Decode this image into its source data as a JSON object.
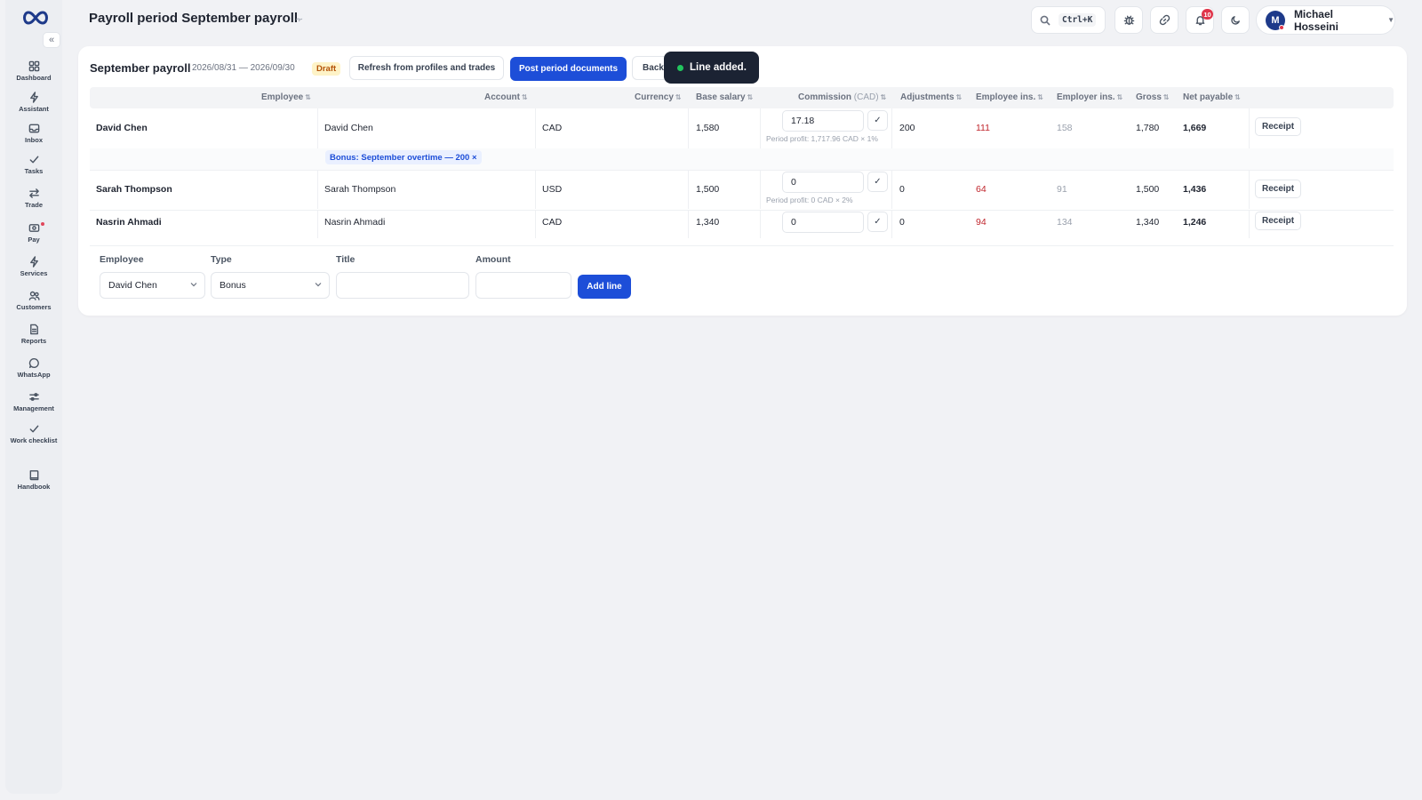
{
  "header": {
    "title": "Payroll period September payroll",
    "search_shortcut": "Ctrl+K",
    "notifications_count": "10",
    "user_initial": "M",
    "user_name": "Michael Hosseini"
  },
  "sidebar": {
    "collapse_glyph": "«",
    "items": [
      {
        "label": "Dashboard",
        "icon": "dashboard-icon"
      },
      {
        "label": "Assistant",
        "icon": "lightning-icon"
      },
      {
        "label": "Inbox",
        "icon": "inbox-icon"
      },
      {
        "label": "Tasks",
        "icon": "check-icon"
      },
      {
        "label": "Trade",
        "icon": "swap-icon"
      },
      {
        "label": "Pay",
        "icon": "wallet-icon"
      },
      {
        "label": "Services",
        "icon": "lightning-icon"
      },
      {
        "label": "Customers",
        "icon": "users-icon"
      },
      {
        "label": "Reports",
        "icon": "document-icon"
      },
      {
        "label": "WhatsApp",
        "icon": "chat-icon"
      },
      {
        "label": "Management",
        "icon": "sliders-icon"
      },
      {
        "label": "Work checklist",
        "icon": "check-icon"
      },
      {
        "label": "Handbook",
        "icon": "book-icon"
      }
    ]
  },
  "period": {
    "title": "September payroll",
    "date_range": "2026/08/31 — 2026/09/30",
    "status": "Draft",
    "refresh_label": "Refresh from profiles and trades",
    "post_label": "Post period documents",
    "back_label": "Back"
  },
  "toast": {
    "message": "Line added."
  },
  "table": {
    "columns": {
      "employee": "Employee",
      "account": "Account",
      "currency": "Currency",
      "base_salary": "Base salary",
      "commission": "Commission",
      "commission_unit": "(CAD)",
      "adjustments": "Adjustments",
      "employee_ins": "Employee ins.",
      "employer_ins": "Employer ins.",
      "gross": "Gross",
      "net_payable": "Net payable"
    },
    "sort_glyph": "⇅",
    "rows": [
      {
        "employee": "David Chen",
        "account": "David Chen",
        "currency": "CAD",
        "base_salary": "1,580",
        "commission": "17.18",
        "commission_hint": "Period profit: 1,717.96 CAD × 1%",
        "adjustments": "200",
        "employee_ins": "111",
        "employer_ins": "158",
        "gross": "1,780",
        "net_payable": "1,669",
        "receipt": "Receipt",
        "adjustment_tag": "Bonus: September overtime — 200 ×"
      },
      {
        "employee": "Sarah Thompson",
        "account": "Sarah Thompson",
        "currency": "USD",
        "base_salary": "1,500",
        "commission": "0",
        "commission_hint": "Period profit: 0 CAD × 2%",
        "adjustments": "0",
        "employee_ins": "64",
        "employer_ins": "91",
        "gross": "1,500",
        "net_payable": "1,436",
        "receipt": "Receipt"
      },
      {
        "employee": "Nasrin Ahmadi",
        "account": "Nasrin Ahmadi",
        "currency": "CAD",
        "base_salary": "1,340",
        "commission": "0",
        "adjustments": "0",
        "employee_ins": "94",
        "employer_ins": "134",
        "gross": "1,340",
        "net_payable": "1,246",
        "receipt": "Receipt"
      }
    ],
    "check_glyph": "✓"
  },
  "add_line": {
    "employee_label": "Employee",
    "employee_value": "David Chen",
    "type_label": "Type",
    "type_value": "Bonus",
    "title_label": "Title",
    "title_value": "",
    "amount_label": "Amount",
    "amount_value": "",
    "submit_label": "Add line"
  },
  "colors": {
    "primary": "#1d4ed8",
    "danger": "#c0262d",
    "draft_text": "#b45309",
    "toast_bg": "#1b2333"
  }
}
